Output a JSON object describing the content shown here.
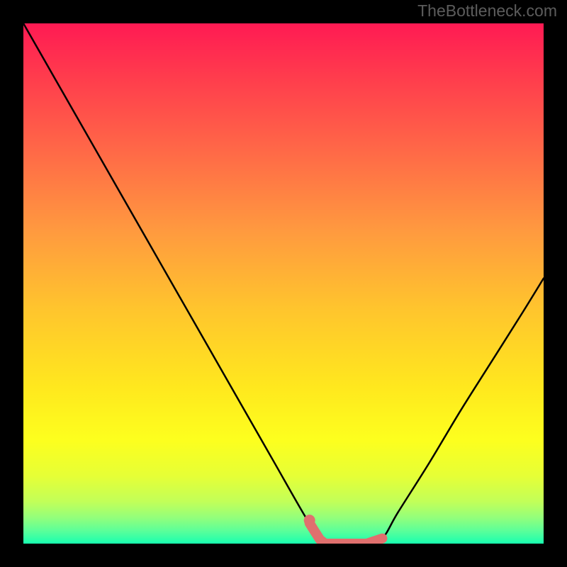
{
  "watermark": "TheBottleneck.com",
  "chart_data": {
    "type": "line",
    "x": [
      0.0,
      0.06,
      0.12,
      0.18,
      0.24,
      0.3,
      0.36,
      0.42,
      0.48,
      0.54,
      0.575,
      0.6,
      0.63,
      0.66,
      0.69,
      0.72,
      0.78,
      0.84,
      0.9,
      0.96,
      1.0
    ],
    "values": [
      1.0,
      0.895,
      0.79,
      0.685,
      0.58,
      0.475,
      0.37,
      0.265,
      0.16,
      0.055,
      0.0,
      0.0,
      0.0,
      0.0,
      0.01,
      0.06,
      0.155,
      0.255,
      0.35,
      0.445,
      0.51
    ],
    "title": "",
    "xlabel": "",
    "ylabel": "",
    "xlim": [
      0,
      1
    ],
    "ylim": [
      0,
      1
    ],
    "annotations": [
      {
        "type": "bottom_highlight",
        "x_start": 0.55,
        "x_end": 0.69,
        "color": "#e0706e"
      }
    ],
    "background_gradient": {
      "stops": [
        {
          "offset": 0.0,
          "color": "#ff1a53"
        },
        {
          "offset": 0.1,
          "color": "#ff3b4d"
        },
        {
          "offset": 0.25,
          "color": "#ff6a47"
        },
        {
          "offset": 0.4,
          "color": "#ff9a3f"
        },
        {
          "offset": 0.55,
          "color": "#ffc52d"
        },
        {
          "offset": 0.7,
          "color": "#ffe81e"
        },
        {
          "offset": 0.8,
          "color": "#fdff1e"
        },
        {
          "offset": 0.87,
          "color": "#e6ff36"
        },
        {
          "offset": 0.92,
          "color": "#c1ff59"
        },
        {
          "offset": 0.95,
          "color": "#93ff7b"
        },
        {
          "offset": 0.975,
          "color": "#5cff99"
        },
        {
          "offset": 1.0,
          "color": "#19ffb0"
        }
      ]
    }
  }
}
